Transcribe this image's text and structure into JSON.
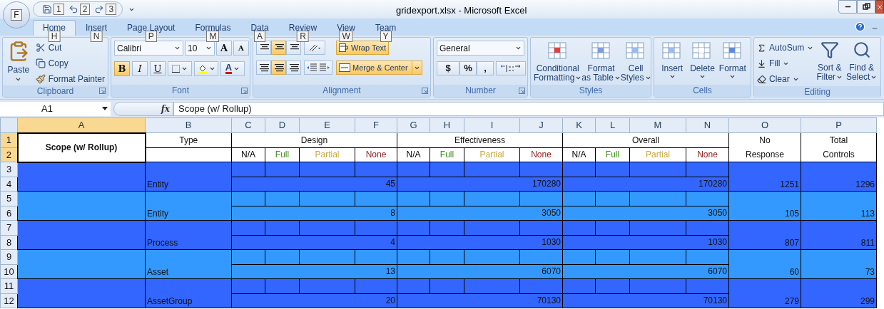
{
  "window": {
    "title": "gridexport.xlsx - Microsoft Excel"
  },
  "office_button": {
    "keytip": "F"
  },
  "quick_access": [
    {
      "keytip": "1"
    },
    {
      "keytip": "2"
    },
    {
      "keytip": "3"
    }
  ],
  "tabs": [
    {
      "label": "Home",
      "keytip": "H",
      "selected": true
    },
    {
      "label": "Insert",
      "keytip": "N",
      "selected": false
    },
    {
      "label": "Page Layout",
      "keytip": "P",
      "selected": false
    },
    {
      "label": "Formulas",
      "keytip": "M",
      "selected": false
    },
    {
      "label": "Data",
      "keytip": "A",
      "selected": false
    },
    {
      "label": "Review",
      "keytip": "R",
      "selected": false
    },
    {
      "label": "View",
      "keytip": "W",
      "selected": false
    },
    {
      "label": "Team",
      "keytip": "Y",
      "selected": false
    }
  ],
  "ribbon": {
    "clipboard": {
      "label": "Clipboard",
      "paste": "Paste",
      "cut": "Cut",
      "copy": "Copy",
      "format_painter": "Format Painter"
    },
    "font": {
      "label": "Font",
      "font_name": "Calibri",
      "font_size": "10",
      "grow_font": "A",
      "shrink_font": "A",
      "font_color": "A",
      "styles": [
        {
          "text": "B",
          "selected": true
        },
        {
          "text": "I",
          "selected": false
        },
        {
          "text": "U",
          "selected": false
        }
      ]
    },
    "alignment": {
      "label": "Alignment",
      "vertical": [
        {
          "selected": false
        },
        {
          "selected": true
        },
        {
          "selected": false
        }
      ],
      "horizontal": [
        {
          "selected": false
        },
        {
          "selected": true
        },
        {
          "selected": false
        }
      ],
      "wrap_text": {
        "label": "Wrap Text",
        "selected": true
      },
      "merge_center": {
        "label": "Merge & Center",
        "selected": true
      }
    },
    "number": {
      "label": "Number",
      "format": "General",
      "symbols": [
        "$",
        "%",
        ","
      ]
    },
    "styles": {
      "label": "Styles",
      "buttons": [
        {
          "lines": [
            "Conditional",
            "Formatting"
          ]
        },
        {
          "lines": [
            "Format",
            "as Table"
          ]
        },
        {
          "lines": [
            "Cell",
            "Styles"
          ]
        }
      ]
    },
    "cells": {
      "label": "Cells",
      "buttons": [
        "Insert",
        "Delete",
        "Format"
      ]
    },
    "editing": {
      "label": "Editing",
      "small": [
        "AutoSum",
        "Fill",
        "Clear"
      ],
      "large": [
        {
          "lines": [
            "Sort &",
            "Filter"
          ]
        },
        {
          "lines": [
            "Find &",
            "Select"
          ]
        }
      ]
    }
  },
  "formula_bar": {
    "name_box": "A1",
    "fx": "fx",
    "value": "Scope (w/ Rollup)"
  },
  "sheet": {
    "columns": [
      {
        "letter": "A",
        "selected": true
      },
      {
        "letter": "B",
        "selected": false
      },
      {
        "letter": "C",
        "selected": false
      },
      {
        "letter": "D",
        "selected": false
      },
      {
        "letter": "E",
        "selected": false
      },
      {
        "letter": "F",
        "selected": false
      },
      {
        "letter": "G",
        "selected": false
      },
      {
        "letter": "H",
        "selected": false
      },
      {
        "letter": "I",
        "selected": false
      },
      {
        "letter": "J",
        "selected": false
      },
      {
        "letter": "K",
        "selected": false
      },
      {
        "letter": "L",
        "selected": false
      },
      {
        "letter": "M",
        "selected": false
      },
      {
        "letter": "N",
        "selected": false
      },
      {
        "letter": "O",
        "selected": false
      },
      {
        "letter": "P",
        "selected": false
      }
    ],
    "rows": [
      {
        "label": "1",
        "selected": true
      },
      {
        "label": "2",
        "selected": true
      },
      {
        "label": "3",
        "selected": false
      },
      {
        "label": "4",
        "selected": false
      },
      {
        "label": "5",
        "selected": false
      },
      {
        "label": "6",
        "selected": false
      },
      {
        "label": "7",
        "selected": false
      },
      {
        "label": "8",
        "selected": false
      },
      {
        "label": "9",
        "selected": false
      },
      {
        "label": "10",
        "selected": false
      },
      {
        "label": "11",
        "selected": false
      },
      {
        "label": "12",
        "selected": false
      }
    ],
    "header": {
      "scope": "Scope (w/ Rollup)",
      "type": "Type",
      "groups": [
        {
          "title": "Design",
          "subs": [
            {
              "label": "N/A",
              "color": "#000000"
            },
            {
              "label": "Full",
              "color": "#3f8f1f"
            },
            {
              "label": "Partial",
              "color": "#c9a83a"
            },
            {
              "label": "None",
              "color": "#8b1c1c"
            }
          ]
        },
        {
          "title": "Effectiveness",
          "subs": [
            {
              "label": "N/A",
              "color": "#000000"
            },
            {
              "label": "Full",
              "color": "#3f8f1f"
            },
            {
              "label": "Partial",
              "color": "#c9a83a"
            },
            {
              "label": "None",
              "color": "#8b1c1c"
            }
          ]
        },
        {
          "title": "Overall",
          "subs": [
            {
              "label": "N/A",
              "color": "#000000"
            },
            {
              "label": "Full",
              "color": "#3f8f1f"
            },
            {
              "label": "Partial",
              "color": "#c9a83a"
            },
            {
              "label": "None",
              "color": "#8b1c1c"
            }
          ]
        }
      ],
      "no_response": [
        "No",
        "Response"
      ],
      "total": [
        "Total",
        "Controls"
      ]
    },
    "records": [
      {
        "type": "Entity",
        "values": [
          "45",
          "170280",
          "170280"
        ],
        "no_response": "1251",
        "total": "1296",
        "color": "#3366ff"
      },
      {
        "type": "Entity",
        "values": [
          "8",
          "3050",
          "3050"
        ],
        "no_response": "105",
        "total": "113",
        "color": "#3399ff"
      },
      {
        "type": "Process",
        "values": [
          "4",
          "1030",
          "1030"
        ],
        "no_response": "807",
        "total": "811",
        "color": "#3366ff"
      },
      {
        "type": "Asset",
        "values": [
          "13",
          "6070",
          "6070"
        ],
        "no_response": "60",
        "total": "73",
        "color": "#3399ff"
      },
      {
        "type": "AssetGroup",
        "values": [
          "20",
          "70130",
          "70130"
        ],
        "no_response": "279",
        "total": "299",
        "color": "#3366ff"
      }
    ]
  }
}
